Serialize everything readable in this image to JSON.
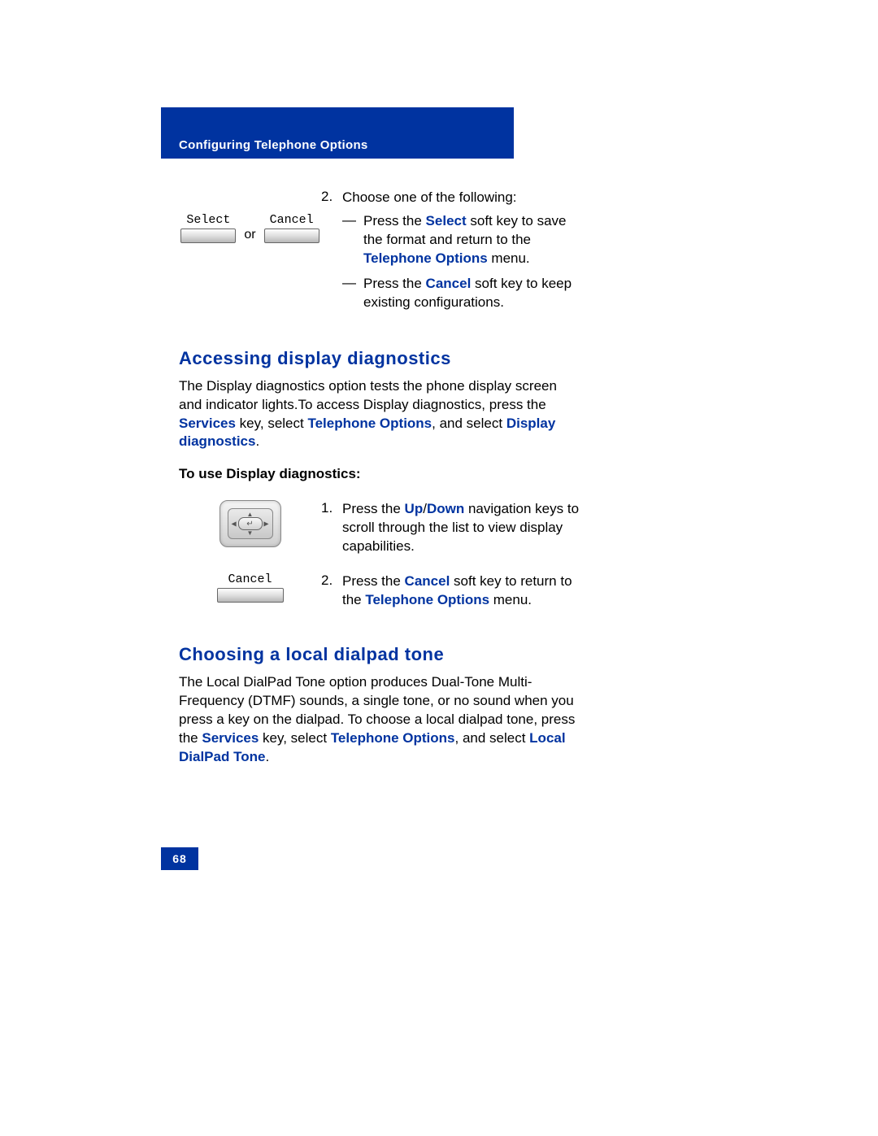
{
  "header": {
    "section_title": "Configuring Telephone Options"
  },
  "step2": {
    "num": "2.",
    "intro": "Choose one of the following:",
    "select_label": "Select",
    "cancel_label": "Cancel",
    "or": "or",
    "dash": "—",
    "opt1_a": "Press the ",
    "opt1_link1": "Select",
    "opt1_b": " soft key to save the format and return to the ",
    "opt1_link2": "Telephone Options",
    "opt1_c": " menu.",
    "opt2_a": "Press the ",
    "opt2_link1": "Cancel",
    "opt2_b": " soft key to keep existing configurations."
  },
  "section1": {
    "heading": "Accessing display diagnostics",
    "para_a": "The Display diagnostics option tests the phone display screen and indicator lights.To access Display diagnostics, press the ",
    "para_link1": "Services",
    "para_b": " key, select ",
    "para_link2": "Telephone Options",
    "para_c": ", and select ",
    "para_link3": "Display diagnostics",
    "para_d": ".",
    "subhead": "To use Display diagnostics:",
    "step1": {
      "num": "1.",
      "a": "Press the ",
      "link1": "Up",
      "slash": "/",
      "link2": "Down",
      "b": " navigation keys to scroll through the list to view display capabilities."
    },
    "step2b": {
      "num": "2.",
      "cancel_label": "Cancel",
      "a": "Press the ",
      "link1": "Cancel",
      "b": " soft key to return to the ",
      "link2": "Telephone Options",
      "c": " menu."
    }
  },
  "section2": {
    "heading": "Choosing a local dialpad tone",
    "para_a": "The Local DialPad Tone option produces Dual-Tone Multi-Frequency (DTMF) sounds, a single tone, or no sound when you press a key on the dialpad. To choose a local dialpad tone, press the ",
    "para_link1": "Services",
    "para_b": " key, select ",
    "para_link2": "Telephone Options",
    "para_c": ", and select ",
    "para_link3": "Local DialPad Tone",
    "para_d": "."
  },
  "page_number": "68"
}
